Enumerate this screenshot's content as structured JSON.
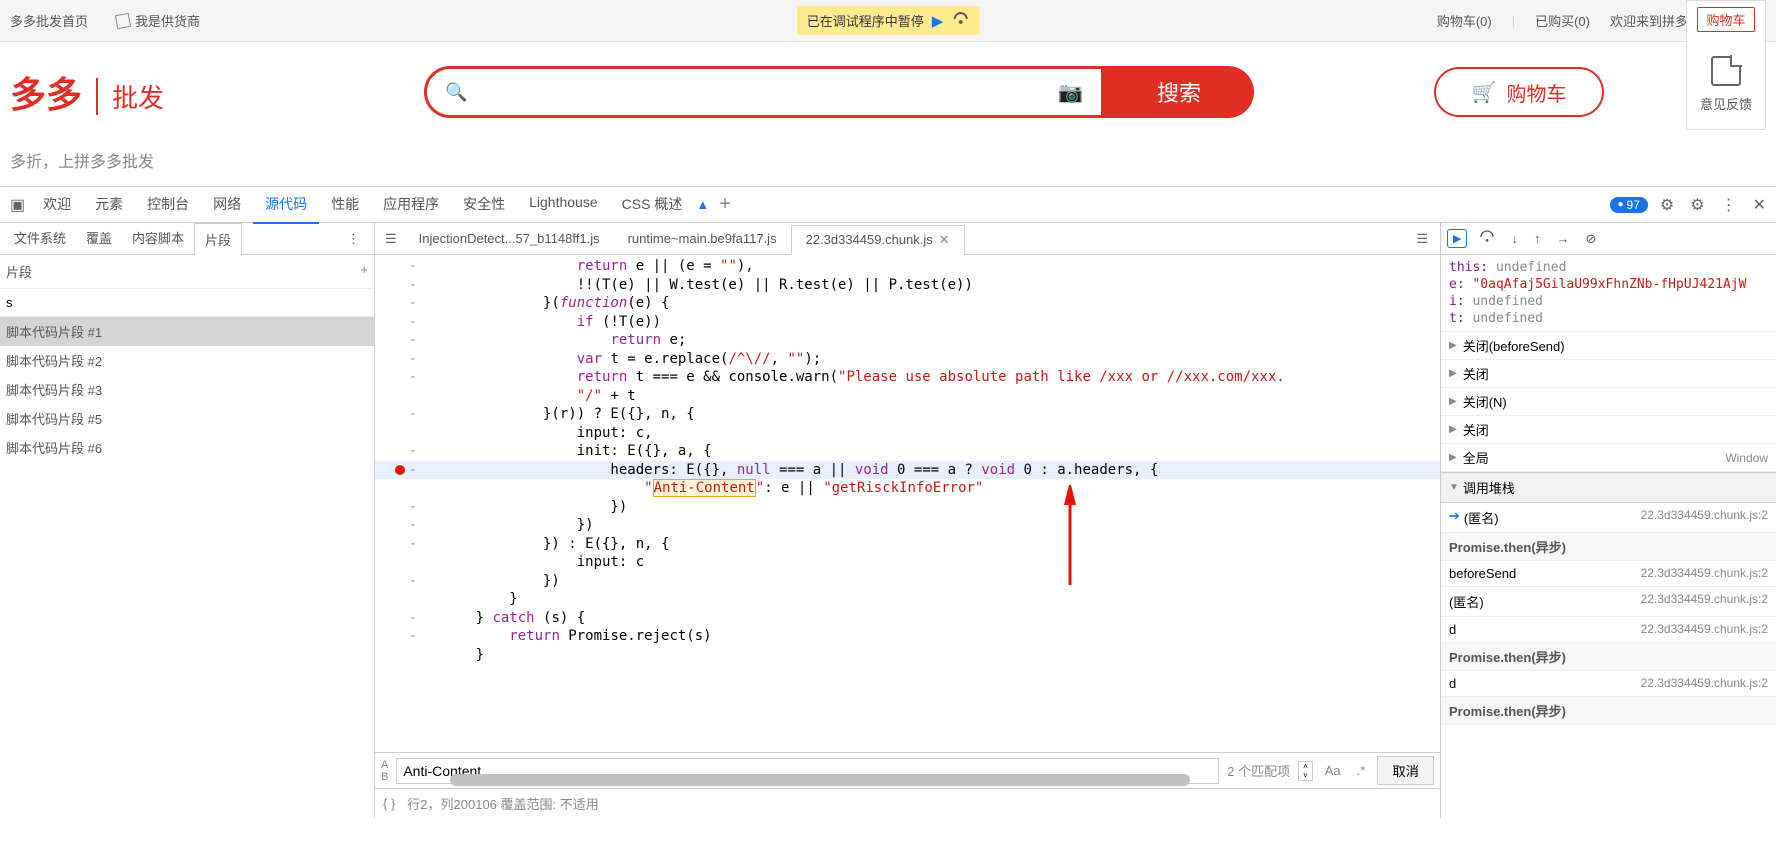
{
  "topbar": {
    "home": "多多批发首页",
    "supplier": "我是供货商",
    "paused": "已在调试程序中暂停",
    "cart": "购物车(0)",
    "bought": "已购买(0)",
    "welcome": "欢迎来到拼多多批发，请先"
  },
  "feedback": {
    "cart_tab": "购物车",
    "text": "意见反馈"
  },
  "header": {
    "logo_main": "多多",
    "logo_sub": "批发",
    "search_btn": "搜索",
    "cart_btn": "购物车"
  },
  "tagline": "多折，上拼多多批发",
  "devtools_tabs": [
    "欢迎",
    "元素",
    "控制台",
    "网络",
    "源代码",
    "性能",
    "应用程序",
    "安全性",
    "Lighthouse",
    "CSS 概述"
  ],
  "devtools_active": 4,
  "devtools_badge": "97",
  "left_panel": {
    "tabs": [
      "文件系统",
      "覆盖",
      "内容脚本",
      "片段"
    ],
    "active": 3,
    "header": "片段",
    "filter_value": "s",
    "snippets": [
      "脚本代码片段 #1",
      "脚本代码片段 #2",
      "脚本代码片段 #3",
      "脚本代码片段 #5",
      "脚本代码片段 #6"
    ],
    "selected": 0
  },
  "files": {
    "tabs": [
      "InjectionDetect...57_b1148ff1.js",
      "runtime~main.be9fa117.js",
      "22.3d334459.chunk.js"
    ],
    "active": 2
  },
  "search": {
    "value": "Anti-Content",
    "matches": "2 个匹配项",
    "cancel": "取消",
    "opt_aa": "Aa",
    "opt_re": ".*"
  },
  "status": "行2，列200106    覆盖范围: 不适用",
  "scope": {
    "this_k": "this:",
    "this_v": "undefined",
    "e_k": "e:",
    "e_v": "\"0aqAfaj5GilaU99xFhnZNb-fHpUJ421AjW",
    "i_k": "i:",
    "i_v": "undefined",
    "t_k": "t:",
    "t_v": "undefined"
  },
  "closures": [
    {
      "label": "关闭(beforeSend)"
    },
    {
      "label": "关闭"
    },
    {
      "label": "关闭(N)"
    },
    {
      "label": "关闭"
    },
    {
      "label": "全局",
      "loc": "Window"
    }
  ],
  "callstack_head": "调用堆栈",
  "callstack": [
    {
      "type": "frame",
      "fn": "(匿名)",
      "src": "22.3d334459.chunk.js:2",
      "current": true
    },
    {
      "type": "async",
      "label": "Promise.then(异步)"
    },
    {
      "type": "frame",
      "fn": "beforeSend",
      "src": "22.3d334459.chunk.js:2"
    },
    {
      "type": "frame",
      "fn": "(匿名)",
      "src": "22.3d334459.chunk.js:2"
    },
    {
      "type": "frame",
      "fn": "d",
      "src": "22.3d334459.chunk.js:2"
    },
    {
      "type": "async",
      "label": "Promise.then(异步)"
    },
    {
      "type": "frame",
      "fn": "d",
      "src": "22.3d334459.chunk.js:2"
    },
    {
      "type": "async",
      "label": "Promise.then(异步)"
    }
  ],
  "code": [
    {
      "g": "-",
      "html": "                  <span class='tok-kw'>return</span> e || (e = <span class='tok-str'>\"\"</span>),"
    },
    {
      "g": "-",
      "html": "                  !!(T(e) || W.test(e) || R.test(e) || P.test(e))"
    },
    {
      "g": "-",
      "html": "              }(<span class='tok-kw tok-fn'>function</span>(e) {"
    },
    {
      "g": "-",
      "html": "                  <span class='tok-kw'>if</span> (!T(e))"
    },
    {
      "g": "-",
      "html": "                      <span class='tok-kw'>return</span> e;"
    },
    {
      "g": "-",
      "html": "                  <span class='tok-kw'>var</span> t = e.replace(<span class='tok-str'>/^\\//</span>, <span class='tok-str'>\"\"</span>);"
    },
    {
      "g": "-",
      "html": "                  <span class='tok-kw'>return</span> t === e && console.warn(<span class='tok-str'>\"Please use absolute path like /xxx or //xxx.com/xxx.</span>"
    },
    {
      "g": "",
      "html": "                  <span class='tok-str'>\"/\"</span> + t"
    },
    {
      "g": "-",
      "html": "              }(r)) ? E({}, n, {"
    },
    {
      "g": "",
      "html": "                  input: c,"
    },
    {
      "g": "-",
      "html": "                  init: E({}, a, {"
    },
    {
      "g": "-",
      "hl": true,
      "bp": true,
      "html": "                      headers: E({}, <span class='tok-kw'>null</span> === a || <span class='tok-kw'>void</span> 0 === a ? <span class='tok-kw'>void</span> 0 : a.headers, {"
    },
    {
      "g": "",
      "html": "                          <span class='tok-str'>\"<span class='search-match'>Anti-Content</span>\"</span>: e || <span class='tok-str'>\"getRisckInfoError\"</span>"
    },
    {
      "g": "-",
      "html": "                      })"
    },
    {
      "g": "-",
      "html": "                  })"
    },
    {
      "g": "-",
      "html": "              }) : E({}, n, {"
    },
    {
      "g": "",
      "html": "                  input: c"
    },
    {
      "g": "-",
      "html": "              })"
    },
    {
      "g": "",
      "html": "          }"
    },
    {
      "g": "-",
      "html": "      } <span class='tok-kw'>catch</span> (s) {"
    },
    {
      "g": "-",
      "html": "          <span class='tok-kw'>return</span> Promise.reject(s)"
    },
    {
      "g": "",
      "html": "      }"
    }
  ]
}
